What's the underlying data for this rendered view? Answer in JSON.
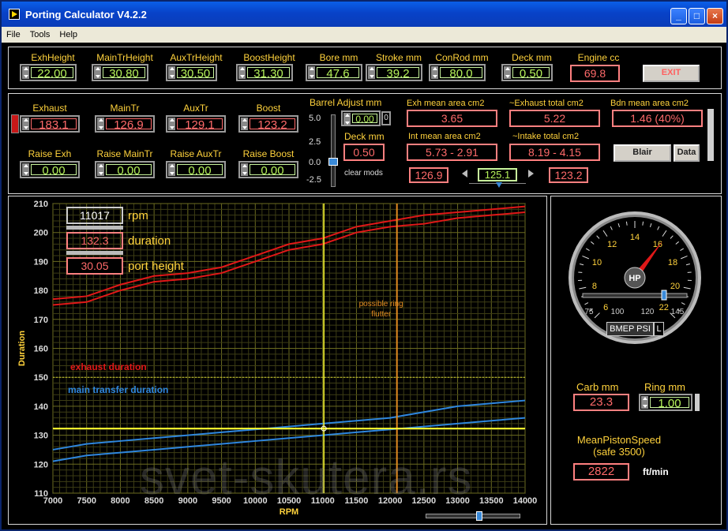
{
  "window": {
    "title": "Porting Calculator V4.2.2",
    "min": "_",
    "max": "□",
    "close": "×"
  },
  "menu": [
    "File",
    "Tools",
    "Help"
  ],
  "top_row": [
    {
      "label": "ExhHeight",
      "value": "22.00"
    },
    {
      "label": "MainTrHeight",
      "value": "30.80"
    },
    {
      "label": "AuxTrHeight",
      "value": "30.50"
    },
    {
      "label": "BoostHeight",
      "value": "31.30"
    },
    {
      "label": "Bore mm",
      "value": "47.6"
    },
    {
      "label": "Stroke mm",
      "value": "39.2"
    },
    {
      "label": "ConRod mm",
      "value": "80.0"
    },
    {
      "label": "Deck mm",
      "value": "0.50"
    },
    {
      "label": "Engine cc",
      "value": "69.8"
    }
  ],
  "exit_label": "EXIT",
  "durations": [
    {
      "label": "Exhaust",
      "value": "183.1"
    },
    {
      "label": "MainTr",
      "value": "126.9"
    },
    {
      "label": "AuxTr",
      "value": "129.1"
    },
    {
      "label": "Boost",
      "value": "123.2"
    }
  ],
  "raises": [
    {
      "label": "Raise Exh",
      "value": "0.00"
    },
    {
      "label": "Raise MainTr",
      "value": "0.00"
    },
    {
      "label": "Raise AuxTr",
      "value": "0.00"
    },
    {
      "label": "Raise Boost",
      "value": "0.00"
    }
  ],
  "barrel": {
    "label": "Barrel Adjust mm",
    "ticks": [
      "5.0",
      "2.5",
      "0.0",
      "-2.5"
    ],
    "value": "0.00",
    "digit": "0",
    "deck_label": "Deck mm",
    "deck_value": "0.50",
    "clear_mods": "clear mods"
  },
  "areas": {
    "exh_mean_label": "Exh mean area cm2",
    "exh_mean": "3.65",
    "exh_total_label": "~Exhaust total cm2",
    "exh_total": "5.22",
    "bdn_label": "Bdn mean area cm2",
    "bdn": "1.46  (40%)",
    "int_mean_label": "Int mean area cm2",
    "int_mean": "5.73 - 2.91",
    "int_total_label": "~Intake total cm2",
    "int_total": "8.19 - 4.15"
  },
  "slider_row": {
    "left": "126.9",
    "mid": "125.1",
    "right": "123.2"
  },
  "buttons": {
    "blair": "Blair",
    "data": "Data"
  },
  "readouts": {
    "rpm": "11017",
    "rpm_label": "rpm",
    "duration": "132.3",
    "duration_label": "duration",
    "port_height": "30.05",
    "port_height_label": "port height"
  },
  "annotations": {
    "ring": "possible ring\nflutter",
    "exhaust": "exhaust duration",
    "main": "main transfer duration"
  },
  "gauge": {
    "label": "HP",
    "ticks": [
      "6",
      "8",
      "10",
      "12",
      "14",
      "16",
      "18",
      "20",
      "22"
    ],
    "value": 16.2,
    "slider_ticks": [
      "75",
      "100",
      "120",
      "145"
    ],
    "bmep_label": "BMEP PSI",
    "bmep_unit": "L"
  },
  "carb": {
    "label": "Carb mm",
    "value": "23.3"
  },
  "ring": {
    "label": "Ring mm",
    "value": "1.00"
  },
  "piston": {
    "label": "MeanPistonSpeed\n(safe 3500)",
    "value": "2822",
    "unit": "ft/min"
  },
  "watermark": "svet-skutera.rs",
  "colors": {
    "exhaust": "#e01818",
    "transfer": "#2e86de",
    "cursor": "#ffff30",
    "marker": "#e08a20"
  },
  "chart_data": {
    "type": "line",
    "xlabel": "RPM",
    "ylabel": "Duration",
    "xlim": [
      7000,
      14000
    ],
    "ylim": [
      110,
      210
    ],
    "xticks": [
      7000,
      7500,
      8000,
      8500,
      9000,
      9500,
      10000,
      10500,
      11000,
      11500,
      12000,
      12500,
      13000,
      13500,
      14000
    ],
    "yticks": [
      110,
      120,
      130,
      140,
      150,
      160,
      170,
      180,
      190,
      200,
      210
    ],
    "series": [
      {
        "name": "exhaust duration",
        "x": [
          7000,
          7500,
          8000,
          8500,
          9000,
          9500,
          10000,
          10500,
          11000,
          11500,
          12000,
          12500,
          13000,
          13500,
          14000
        ],
        "y": [
          177,
          178,
          182,
          185,
          186,
          188,
          192,
          196,
          198,
          202,
          204,
          206,
          207,
          208,
          209
        ]
      },
      {
        "name": "",
        "x": [
          7000,
          7500,
          8000,
          8500,
          9000,
          9500,
          10000,
          10500,
          11000,
          11500,
          12000,
          12500,
          13000,
          13500,
          14000
        ],
        "y": [
          175,
          176,
          180,
          183,
          184,
          186,
          190,
          194,
          196,
          200,
          202,
          203,
          205,
          206,
          207
        ]
      },
      {
        "name": "main transfer duration",
        "x": [
          7000,
          7500,
          8000,
          8500,
          9000,
          9500,
          10000,
          10500,
          11000,
          11500,
          12000,
          12500,
          13000,
          13500,
          14000
        ],
        "y": [
          125,
          127,
          128,
          129,
          130,
          131,
          132,
          133,
          134,
          135,
          136,
          138,
          140,
          141,
          142
        ]
      },
      {
        "name": "",
        "x": [
          7000,
          7500,
          8000,
          8500,
          9000,
          9500,
          10000,
          10500,
          11000,
          11500,
          12000,
          12500,
          13000,
          13500,
          14000
        ],
        "y": [
          121,
          123,
          124,
          125,
          126,
          127,
          128,
          129,
          130,
          131,
          132,
          133,
          134,
          135,
          136
        ]
      }
    ],
    "cursor_x": 11017,
    "cursor_y": 132.3,
    "marker_x": 12100,
    "dashed_y": 150
  }
}
